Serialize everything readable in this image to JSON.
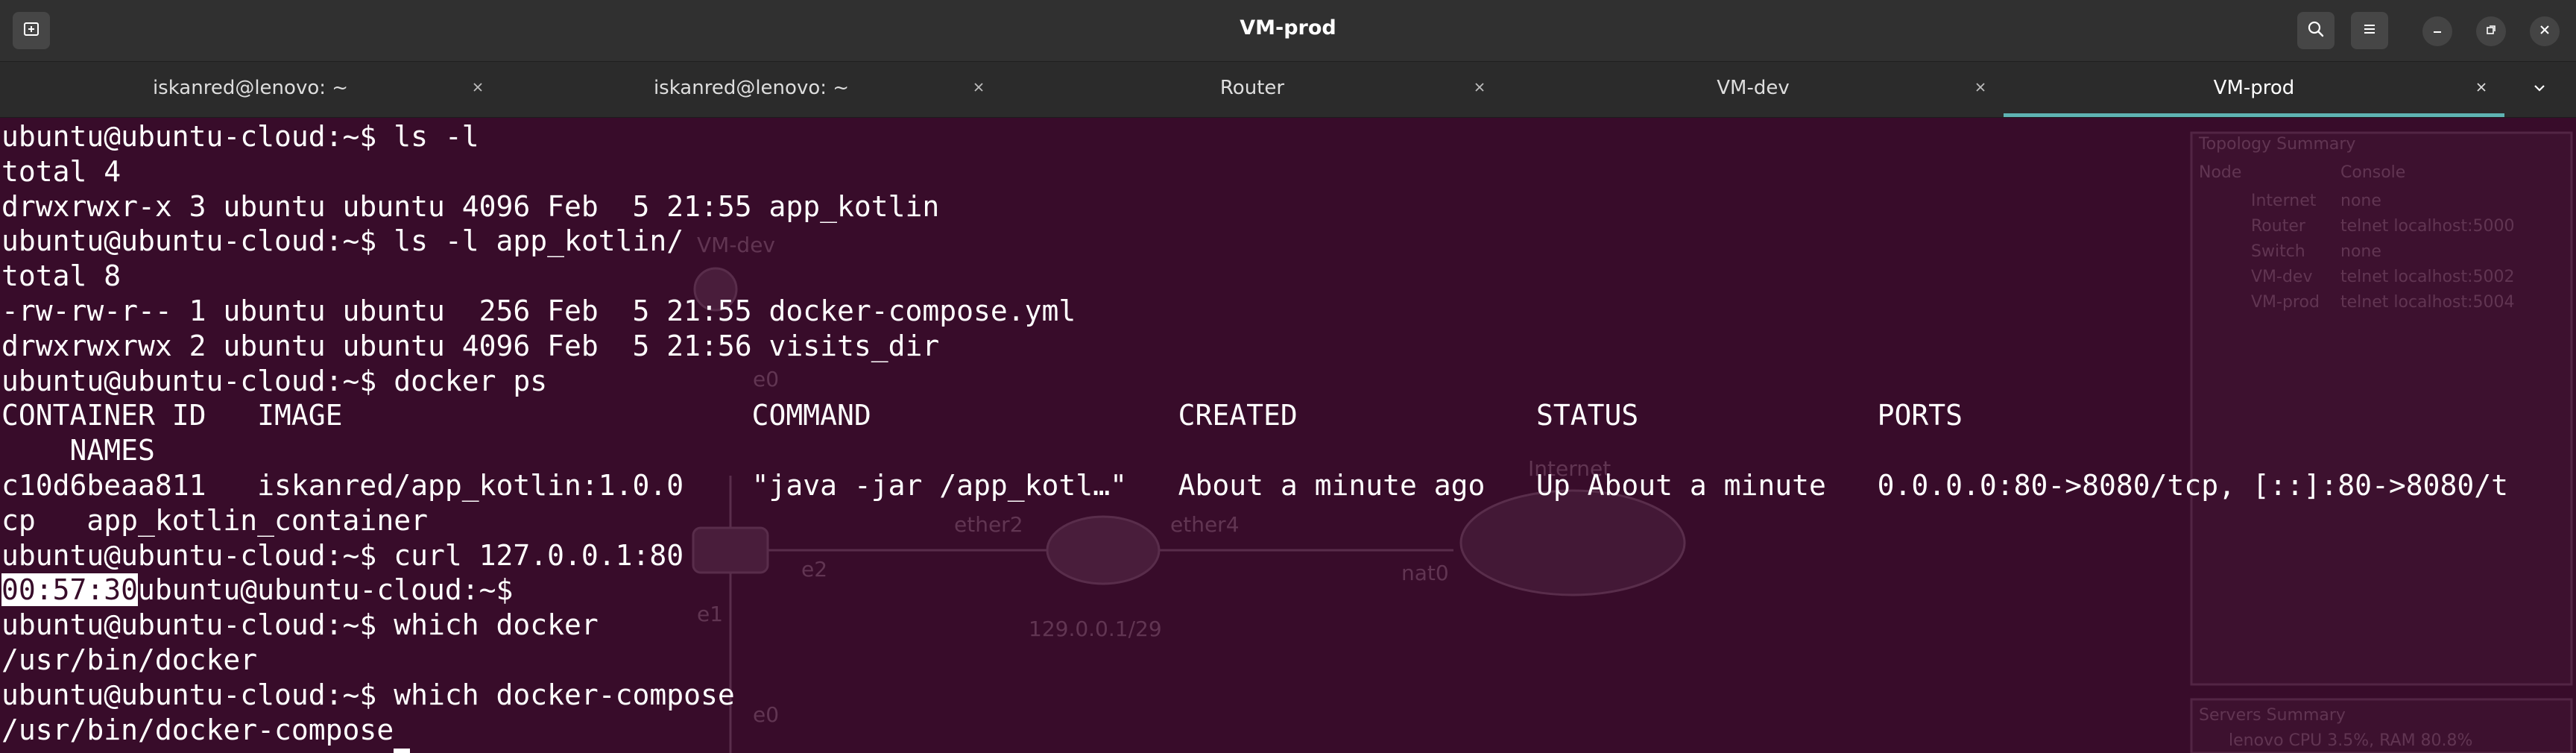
{
  "window": {
    "title": "VM-prod"
  },
  "header": {
    "new_tab_icon": "new-tab-icon",
    "search_icon": "search-icon",
    "menu_icon": "hamburger-menu-icon",
    "minimize_icon": "minimize-icon",
    "maximize_icon": "restore-icon",
    "close_icon": "close-icon"
  },
  "tabs": [
    {
      "label": "iskanred@lenovo: ~",
      "active": false
    },
    {
      "label": "iskanred@lenovo: ~",
      "active": false
    },
    {
      "label": "Router",
      "active": false
    },
    {
      "label": "VM-dev",
      "active": false
    },
    {
      "label": "VM-prod",
      "active": true
    }
  ],
  "colors": {
    "terminal_bg": "#380c2a",
    "terminal_fg": "#ffffff",
    "header_bg": "#303030",
    "tabbar_bg": "#2b2b2b",
    "active_tab_indicator": "#5fb3b3"
  },
  "terminal": {
    "lines": [
      {
        "text": "ubuntu@ubuntu-cloud:~$ ls -l"
      },
      {
        "text": "total 4"
      },
      {
        "text": "drwxrwxr-x 3 ubuntu ubuntu 4096 Feb  5 21:55 app_kotlin"
      },
      {
        "text": "ubuntu@ubuntu-cloud:~$ ls -l app_kotlin/"
      },
      {
        "text": "total 8"
      },
      {
        "text": "-rw-rw-r-- 1 ubuntu ubuntu  256 Feb  5 21:55 docker-compose.yml"
      },
      {
        "text": "drwxrwxrwx 2 ubuntu ubuntu 4096 Feb  5 21:56 visits_dir"
      },
      {
        "text": "ubuntu@ubuntu-cloud:~$ docker ps"
      },
      {
        "text": "CONTAINER ID   IMAGE                        COMMAND                  CREATED              STATUS              PORTS"
      },
      {
        "text": "    NAMES"
      },
      {
        "text": "c10d6beaa811   iskanred/app_kotlin:1.0.0    \"java -jar /app_kotl…\"   About a minute ago   Up About a minute   0.0.0.0:80->8080/tcp, [::]:80->8080/t"
      },
      {
        "text": "cp   app_kotlin_container"
      },
      {
        "text": "ubuntu@ubuntu-cloud:~$ curl 127.0.0.1:80"
      },
      {
        "highlight": "00:57:30",
        "text": "ubuntu@ubuntu-cloud:~$"
      },
      {
        "text": "ubuntu@ubuntu-cloud:~$ which docker"
      },
      {
        "text": "/usr/bin/docker"
      },
      {
        "text": "ubuntu@ubuntu-cloud:~$ which docker-compose"
      },
      {
        "text": "/usr/bin/docker-compose"
      }
    ],
    "cursor": "block"
  },
  "background_window": {
    "node_labels": [
      "VM-dev",
      "e0",
      "e0",
      "e2",
      "e1",
      "e0",
      "ether2",
      "ether4",
      "nat0",
      "Internet"
    ],
    "subnet_label": "129.0.0.1/29",
    "panel_title": "Topology Summary",
    "panel_columns": [
      "Node",
      "Console"
    ],
    "panel_rows": [
      {
        "node": "Internet",
        "console": "none"
      },
      {
        "node": "Router",
        "console": "telnet localhost:5000"
      },
      {
        "node": "Switch",
        "console": "none"
      },
      {
        "node": "VM-dev",
        "console": "telnet localhost:5002"
      },
      {
        "node": "VM-prod",
        "console": "telnet localhost:5004"
      }
    ],
    "servers_title": "Servers Summary",
    "servers_row": "lenovo CPU 3.5%, RAM 80.8%"
  }
}
